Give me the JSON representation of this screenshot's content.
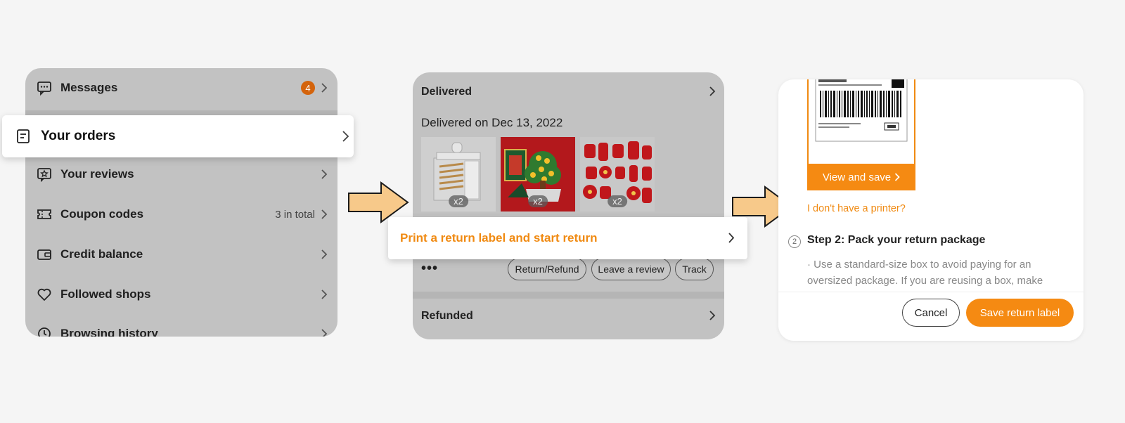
{
  "menu": {
    "messages": {
      "label": "Messages",
      "badge": "4"
    },
    "orders": {
      "label": "Your orders"
    },
    "reviews": {
      "label": "Your reviews"
    },
    "coupons": {
      "label": "Coupon codes",
      "value": "3 in total"
    },
    "credit": {
      "label": "Credit balance"
    },
    "followed": {
      "label": "Followed shops"
    },
    "history": {
      "label": "Browsing history"
    }
  },
  "order": {
    "status": "Delivered",
    "date": "Delivered on Dec 13, 2022",
    "items": [
      {
        "icon": "acrylic-box-image",
        "qty": "x2"
      },
      {
        "icon": "money-tree-image",
        "qty": "x2"
      },
      {
        "icon": "red-stickers-image",
        "qty": "x2"
      }
    ],
    "actions": [
      "Return/Refund",
      "Leave a review",
      "Track"
    ],
    "refunded": "Refunded",
    "print_label": "Print a return label and start return"
  },
  "return": {
    "view_save": "View and save",
    "no_printer": "I don't have a printer?",
    "step_num": "2",
    "step_title": "Step 2: Pack your return package",
    "step_text": "· Use a standard-size box to avoid paying for an oversized package. If you are reusing a box, make",
    "cancel": "Cancel",
    "save": "Save return label"
  },
  "colors": {
    "accent": "#f58a12",
    "arrow": "#f7c98a"
  }
}
